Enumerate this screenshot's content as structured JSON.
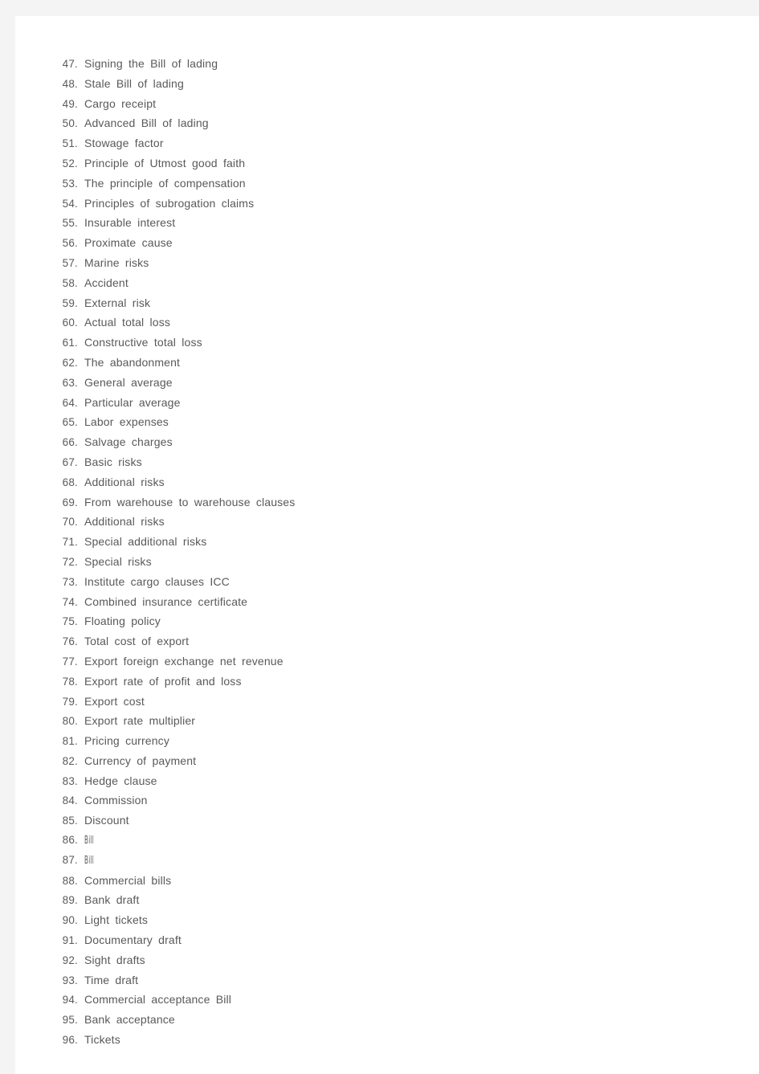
{
  "page": {
    "background_color": "#f4f4f5",
    "sheet_color": "#ffffff",
    "text_color": "#595959",
    "number_color": "#5a5a5a"
  },
  "list": {
    "name": "international-trade-terms-list",
    "start_number": 47,
    "end_number": 96,
    "items": [
      {
        "number": "47.",
        "text": "Signing the Bill of lading",
        "condensed": false
      },
      {
        "number": "48.",
        "text": "Stale Bill of lading",
        "condensed": false
      },
      {
        "number": "49.",
        "text": "Cargo receipt",
        "condensed": false
      },
      {
        "number": "50.",
        "text": "Advanced Bill of lading",
        "condensed": false
      },
      {
        "number": "51.",
        "text": "Stowage factor",
        "condensed": false
      },
      {
        "number": "52.",
        "text": "Principle of Utmost good faith",
        "condensed": false
      },
      {
        "number": "53.",
        "text": "The principle of compensation",
        "condensed": false
      },
      {
        "number": "54.",
        "text": "Principles of subrogation claims",
        "condensed": false
      },
      {
        "number": "55.",
        "text": "Insurable interest",
        "condensed": false
      },
      {
        "number": "56.",
        "text": "Proximate cause",
        "condensed": false
      },
      {
        "number": "57.",
        "text": "Marine risks",
        "condensed": false
      },
      {
        "number": "58.",
        "text": "Accident",
        "condensed": false
      },
      {
        "number": "59.",
        "text": "External risk",
        "condensed": false
      },
      {
        "number": "60.",
        "text": "Actual total loss",
        "condensed": false
      },
      {
        "number": "61.",
        "text": "Constructive total loss",
        "condensed": false
      },
      {
        "number": "62.",
        "text": "The abandonment",
        "condensed": false
      },
      {
        "number": "63.",
        "text": "General average",
        "condensed": false
      },
      {
        "number": "64.",
        "text": "Particular average",
        "condensed": false
      },
      {
        "number": "65.",
        "text": "Labor expenses",
        "condensed": false
      },
      {
        "number": "66.",
        "text": "Salvage charges",
        "condensed": false
      },
      {
        "number": "67.",
        "text": "Basic risks",
        "condensed": false
      },
      {
        "number": "68.",
        "text": "Additional risks",
        "condensed": false
      },
      {
        "number": "69.",
        "text": "From warehouse to warehouse clauses",
        "condensed": false
      },
      {
        "number": "70.",
        "text": "Additional risks",
        "condensed": false
      },
      {
        "number": "71.",
        "text": "Special additional risks",
        "condensed": false
      },
      {
        "number": "72.",
        "text": "Special risks",
        "condensed": false
      },
      {
        "number": "73.",
        "text": "Institute cargo clauses ICC",
        "condensed": false
      },
      {
        "number": "74.",
        "text": "Combined insurance certificate",
        "condensed": false
      },
      {
        "number": "75.",
        "text": "Floating policy",
        "condensed": false
      },
      {
        "number": "76.",
        "text": "Total cost of export",
        "condensed": false
      },
      {
        "number": "77.",
        "text": "Export foreign exchange net revenue",
        "condensed": false
      },
      {
        "number": "78.",
        "text": "Export rate of profit and loss",
        "condensed": false
      },
      {
        "number": "79.",
        "text": "Export cost",
        "condensed": false
      },
      {
        "number": "80.",
        "text": "Export rate multiplier",
        "condensed": false
      },
      {
        "number": "81.",
        "text": "Pricing currency",
        "condensed": false
      },
      {
        "number": "82.",
        "text": "Currency of payment",
        "condensed": false
      },
      {
        "number": "83.",
        "text": "Hedge clause",
        "condensed": false
      },
      {
        "number": "84.",
        "text": "Commission",
        "condensed": false
      },
      {
        "number": "85.",
        "text": "Discount",
        "condensed": false
      },
      {
        "number": "86.",
        "text": "Bill",
        "condensed": true
      },
      {
        "number": "87.",
        "text": "Bill",
        "condensed": true
      },
      {
        "number": "88.",
        "text": "Commercial bills",
        "condensed": false
      },
      {
        "number": "89.",
        "text": "Bank draft",
        "condensed": false
      },
      {
        "number": "90.",
        "text": "Light tickets",
        "condensed": false
      },
      {
        "number": "91.",
        "text": "Documentary draft",
        "condensed": false
      },
      {
        "number": "92.",
        "text": "Sight drafts",
        "condensed": false
      },
      {
        "number": "93.",
        "text": "Time draft",
        "condensed": false
      },
      {
        "number": "94.",
        "text": "Commercial acceptance Bill",
        "condensed": false
      },
      {
        "number": "95.",
        "text": "Bank acceptance",
        "condensed": false
      },
      {
        "number": "96.",
        "text": "Tickets",
        "condensed": false
      }
    ]
  }
}
